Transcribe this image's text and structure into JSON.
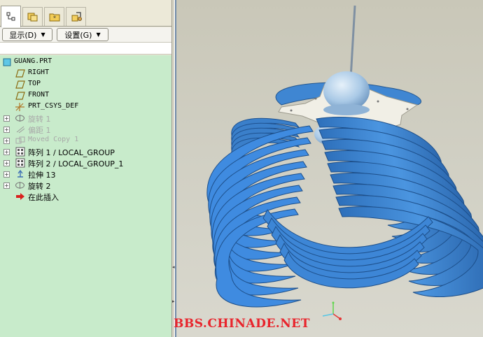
{
  "menus": {
    "display": "显示(D)",
    "settings": "设置(G)"
  },
  "tree": {
    "root": "GUANG.PRT",
    "items": [
      {
        "label": "RIGHT",
        "icon": "datum-plane-icon",
        "dim": false,
        "expander": false
      },
      {
        "label": "TOP",
        "icon": "datum-plane-icon",
        "dim": false,
        "expander": false
      },
      {
        "label": "FRONT",
        "icon": "datum-plane-icon",
        "dim": false,
        "expander": false
      },
      {
        "label": "PRT_CSYS_DEF",
        "icon": "coordinate-system-icon",
        "dim": false,
        "expander": false
      },
      {
        "label": "旋转 1",
        "icon": "revolve-icon",
        "dim": true,
        "expander": true
      },
      {
        "label": "偏距 1",
        "icon": "offset-icon",
        "dim": true,
        "expander": true
      },
      {
        "label": "Moved Copy 1",
        "icon": "moved-copy-icon",
        "dim": true,
        "expander": true
      },
      {
        "label": "阵列 1 / LOCAL_GROUP",
        "icon": "pattern-icon",
        "dim": false,
        "expander": true
      },
      {
        "label": "阵列 2 / LOCAL_GROUP_1",
        "icon": "pattern-icon",
        "dim": false,
        "expander": true
      },
      {
        "label": "拉伸 13",
        "icon": "extrude-icon",
        "dim": false,
        "expander": true
      },
      {
        "label": "旋转 2",
        "icon": "revolve-icon",
        "dim": false,
        "expander": true
      },
      {
        "label": "在此插入",
        "icon": "insert-here-arrow-icon",
        "dim": false,
        "expander": false
      }
    ]
  },
  "watermark": "BBS.CHINADE.NET",
  "colors": {
    "model_blue": "#3d86d6",
    "tree_bg": "#c8ebcb",
    "watermark": "#e8242c"
  }
}
